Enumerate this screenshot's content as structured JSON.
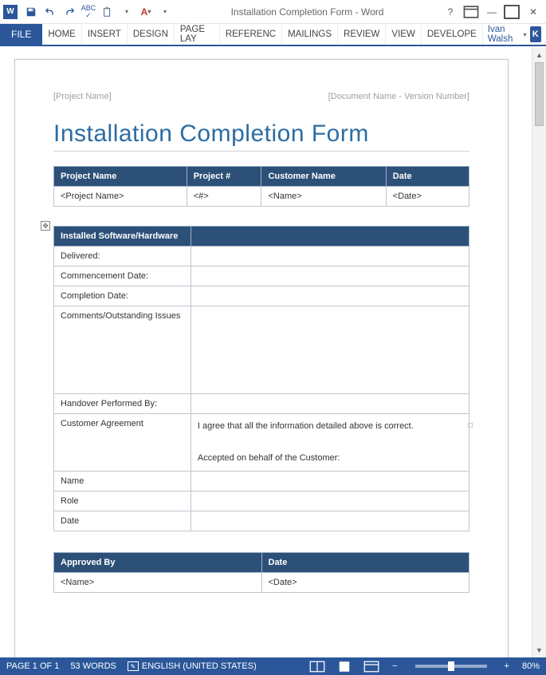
{
  "titlebar": {
    "app_glyph": "W",
    "title": "Installation Completion Form - Word",
    "help_tooltip": "?"
  },
  "ribbon": {
    "file": "FILE",
    "tabs": [
      "HOME",
      "INSERT",
      "DESIGN",
      "PAGE LAY",
      "REFERENC",
      "MAILINGS",
      "REVIEW",
      "VIEW",
      "DEVELOPE"
    ],
    "user_name": "Ivan Walsh",
    "user_initial": "K"
  },
  "doc": {
    "header_left": "[Project Name]",
    "header_right": "[Document Name - Version Number]",
    "title": "Installation Completion Form",
    "table1": {
      "headers": [
        "Project Name",
        "Project #",
        "Customer Name",
        "Date"
      ],
      "row": [
        "<Project Name>",
        "<#>",
        "<Name>",
        "<Date>"
      ]
    },
    "table2": {
      "header": "Installed Software/Hardware",
      "rows": [
        {
          "label": "Delivered:",
          "value": ""
        },
        {
          "label": "Commencement Date:",
          "value": ""
        },
        {
          "label": "Completion Date:",
          "value": ""
        },
        {
          "label": "Comments/Outstanding Issues",
          "value": "",
          "tall": true
        },
        {
          "label": "Handover Performed By:",
          "value": ""
        },
        {
          "label": "Customer Agreement",
          "value": "I agree that all the information detailed above is correct.\n\nAccepted on behalf of the Customer:",
          "agree": true
        },
        {
          "label": "Name",
          "value": ""
        },
        {
          "label": "Role",
          "value": ""
        },
        {
          "label": "Date",
          "value": ""
        }
      ]
    },
    "table3": {
      "headers": [
        "Approved By",
        "Date"
      ],
      "row": [
        "<Name>",
        "<Date>"
      ]
    }
  },
  "statusbar": {
    "page": "PAGE 1 OF 1",
    "words": "53 WORDS",
    "language": "ENGLISH (UNITED STATES)",
    "zoom": "80%"
  }
}
